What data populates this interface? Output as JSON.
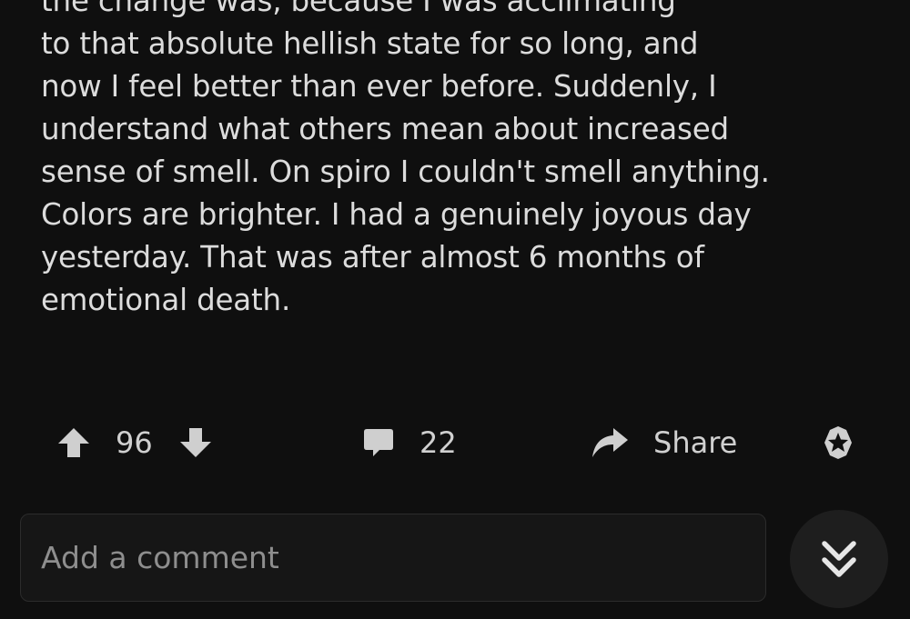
{
  "post": {
    "lines": [
      "the change was, because I was acclimating",
      "to that absolute hellish state for so long, and",
      "now I feel better than ever before. Suddenly, I",
      "understand what others mean about increased",
      "sense of smell. On spiro I couldn't smell anything.",
      "Colors are brighter. I had a genuinely joyous day",
      "yesterday. That was after almost 6 months of",
      "emotional death."
    ]
  },
  "actions": {
    "upvote_icon": "arrow-up-icon",
    "vote_count": "96",
    "downvote_icon": "arrow-down-icon",
    "comment_icon": "speech-bubble-icon",
    "comment_count": "22",
    "share_icon": "share-arrow-icon",
    "share_label": "Share",
    "award_icon": "award-star-icon"
  },
  "comment_input": {
    "placeholder": "Add a comment"
  },
  "jump_button": {
    "icon": "double-chevron-down-icon"
  },
  "colors": {
    "background": "#0f0f0f",
    "text": "#dcdcdc",
    "muted": "#8e8e8e"
  }
}
